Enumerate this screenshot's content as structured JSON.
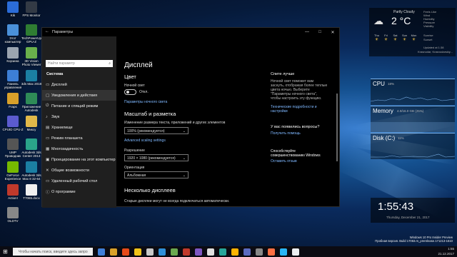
{
  "desktop_icons": [
    {
      "label": "Kik",
      "color": "#2b6cd8"
    },
    {
      "label": "FPS Monitor",
      "color": "#333a45"
    },
    {
      "label": "Этот компьютер",
      "color": "#4a90d9"
    },
    {
      "label": "TechPowerUp GPU-Z",
      "color": "#2f7d32"
    },
    {
      "label": "Корзина",
      "color": "#9aa4b0"
    },
    {
      "label": "3D Vision Photo Viewer",
      "color": "#6ab04c"
    },
    {
      "label": "Панель управления",
      "color": "#3d7fd6"
    },
    {
      "label": "3ds Max 2018",
      "color": "#1b7fa3"
    },
    {
      "label": "Fraps",
      "color": "#d8a02a"
    },
    {
      "label": "Приложение Autodesk",
      "color": "#2e8b57"
    },
    {
      "label": "CPUID CPU-Z",
      "color": "#5b5bcf"
    },
    {
      "label": "Миксу",
      "color": "#e0b84a"
    },
    {
      "label": "UMP Проводник",
      "color": "#555"
    },
    {
      "label": "Autodesk 3ds Center 2013",
      "color": "#2aa38a"
    },
    {
      "label": "GeForce Experience",
      "color": "#76b900"
    },
    {
      "label": "Autodesk 3ds Max 8 32-64",
      "color": "#1b7fa3"
    },
    {
      "label": "Action!",
      "color": "#c0392b"
    },
    {
      "label": "T7065.docx",
      "color": "#f0f0f0"
    },
    {
      "label": "OLDTV",
      "color": "#888"
    }
  ],
  "window": {
    "title": "Параметры",
    "min": "—",
    "max": "□",
    "close": "✕",
    "back": "←"
  },
  "sidebar": {
    "search_placeholder": "Найти параметр",
    "section": "Система",
    "items": [
      {
        "icon": "▭",
        "label": "Дисплей"
      },
      {
        "icon": "▢",
        "label": "Уведомления и действия"
      },
      {
        "icon": "⏻",
        "label": "Питание и спящий режим"
      },
      {
        "icon": "♪",
        "label": "Звук"
      },
      {
        "icon": "▤",
        "label": "Хранилище"
      },
      {
        "icon": "▭",
        "label": "Режим планшета"
      },
      {
        "icon": "▦",
        "label": "Многозадачность"
      },
      {
        "icon": "▣",
        "label": "Проецирование на этот компьютер"
      },
      {
        "icon": "✕",
        "label": "Общие возможности"
      },
      {
        "icon": "▭",
        "label": "Удаленный рабочий стол"
      },
      {
        "icon": "ⓘ",
        "label": "О программе"
      }
    ]
  },
  "content": {
    "heading": "Дисплей",
    "color_heading": "Цвет",
    "night_light_label": "Ночной свет",
    "night_light_state": "Откл.",
    "night_light_link": "Параметры ночного света",
    "scale_heading": "Масштаб и разметка",
    "scale_label": "Изменение размера текста, приложений и других элементов",
    "scale_value": "100% (рекомендуется)",
    "scale_link": "Advanced scaling settings",
    "resolution_label": "Разрешение",
    "resolution_value": "1920 × 1080 (рекомендуется)",
    "orientation_label": "Ориентация",
    "orientation_value": "Альбомная",
    "multi_heading": "Несколько дисплеев",
    "multi_text": "Старые дисплеи могут не всегда подключаться автоматически."
  },
  "right_panel": {
    "sleep_title": "Спите лучше",
    "sleep_text": "Ночной свет поможет вам заснуть, отображая более теплые цвета ночью. Выберите \"Параметры ночного света\", чтобы настроить эту функцию.",
    "sleep_link": "Технические подробности и настройки",
    "question_title": "У вас появились вопросы?",
    "question_link": "Получить помощь",
    "improve_title": "Способствуйте совершенствованию Windows",
    "improve_link": "Оставить отзыв"
  },
  "weather": {
    "condition": "Partly Cloudy",
    "temp": "2 °C",
    "details": [
      "Feels Like",
      "Wind",
      "Humidity",
      "Pressure",
      "Visibility"
    ],
    "days": [
      "Thu",
      "Fri",
      "Sat",
      "Sun",
      "Mon"
    ],
    "sunrise": "Sunrise",
    "sunset": "Sunset",
    "updated": "Updated at 1:38",
    "location": "Krasnodar, Krasnodarskiy..."
  },
  "monitors": {
    "cpu_label": "CPU",
    "cpu_value": "18%",
    "mem_label": "Memory",
    "mem_value": "4.0/16.0 GB (25%)",
    "disk_label": "Disk (C:)",
    "disk_value": "11%"
  },
  "clock": {
    "time": "1:55:43",
    "date": "Thursday, December 21, 2017"
  },
  "taskbar": {
    "search_placeholder": "Чтобы начать поиск, введите здесь запро",
    "icon_colors": [
      "#3f7fd8",
      "#d9a12a",
      "#e64a19",
      "#f0c419",
      "#c8c8c8",
      "#2f8fd8",
      "#6aa84f",
      "#c0392b",
      "#7e57c2",
      "#e0e0e0",
      "#26a69a",
      "#ffb300",
      "#5c6bc0",
      "#888888",
      "#ff7043",
      "#29b6f6",
      "#eceff1"
    ],
    "tray_time": "1:55",
    "tray_date": "21.12.2017"
  },
  "watermark": {
    "line1": "Windows 10 Pro Insider Preview",
    "line2": "Пробная версия. Build 17063.rs_prerelease.171213-1610"
  }
}
